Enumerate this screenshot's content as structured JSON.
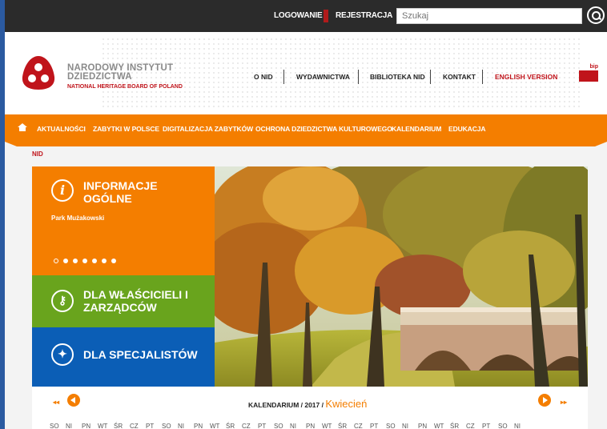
{
  "topbar": {
    "login": "LOGOWANIE",
    "register": "REJESTRACJA",
    "search_placeholder": "Szukaj"
  },
  "header": {
    "brand_line1": "NARODOWY INSTYTUT",
    "brand_line2": "DZIEDZICTWA",
    "brand_sub": "NATIONAL HERITAGE BOARD OF POLAND",
    "nav": [
      "O NID",
      "WYDAWNICTWA",
      "BIBLIOTEKA NID",
      "KONTAKT",
      "ENGLISH VERSION"
    ],
    "bip_label": "bip"
  },
  "orange_nav": {
    "items": [
      "AKTUALNOŚCI",
      "ZABYTKI W POLSCE",
      "DIGITALIZACJA ZABYTKÓW",
      "OCHRONA DZIEDZICTWA KULTUROWEGO",
      "KALENDARIUM",
      "EDUKACJA"
    ]
  },
  "breadcrumb": "NID",
  "panels": {
    "info": {
      "title_line1": "INFORMACJE",
      "title_line2": "OGÓLNE",
      "subtitle": "Park Mużakowski",
      "slides": 7,
      "active_slide": 1
    },
    "owners": {
      "title_line1": "DLA WŁAŚCICIELI I",
      "title_line2": "ZARZĄDCÓW"
    },
    "specialists": {
      "title": "DLA SPECJALISTÓW"
    }
  },
  "calendar": {
    "title_prefix": "KALENDARIUM / 2017 / ",
    "month": "Kwiecień",
    "days": [
      "SO",
      "NI",
      "PN",
      "WT",
      "ŚR",
      "CZ",
      "PT",
      "SO",
      "NI",
      "PN",
      "WT",
      "ŚR",
      "CZ",
      "PT",
      "SO",
      "NI",
      "PN",
      "WT",
      "ŚR",
      "CZ",
      "PT",
      "SO",
      "NI",
      "PN",
      "WT",
      "ŚR",
      "CZ",
      "PT",
      "SO",
      "NI"
    ]
  },
  "colors": {
    "orange": "#f47e00",
    "green": "#69a41d",
    "blue": "#0b5eb6",
    "red": "#c0141b",
    "dark": "#2b2b2b"
  }
}
